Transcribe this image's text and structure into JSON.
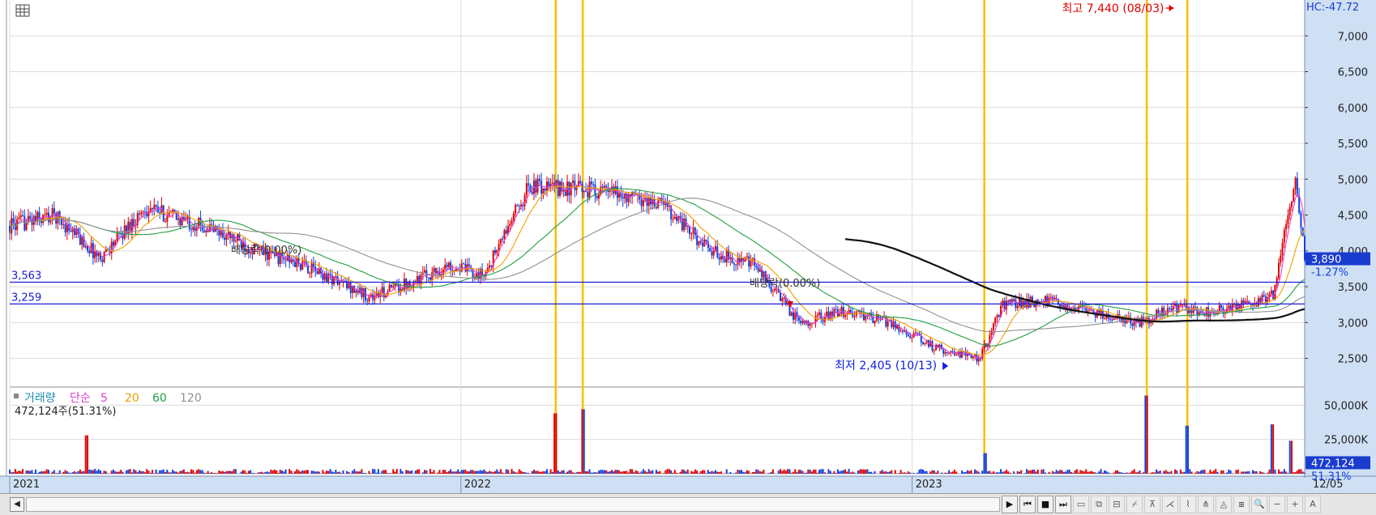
{
  "chart_data": {
    "type": "candlestick",
    "price_axis": {
      "min": 2100,
      "max": 7500,
      "ticks": [
        2500,
        3000,
        3500,
        4000,
        4500,
        5000,
        5500,
        6000,
        6500,
        7000
      ],
      "tick_labels": [
        "2,500",
        "3,000",
        "3,500",
        "4,000",
        "4,500",
        "5,000",
        "5,500",
        "6,000",
        "6,500",
        "7,000"
      ]
    },
    "volume_axis": {
      "max": 62000,
      "ticks": [
        25000,
        50000
      ],
      "tick_labels": [
        "25,000K",
        "50,000K"
      ]
    },
    "time_axis": {
      "start": 2021.0,
      "end": 2023.87,
      "labels": [
        {
          "t": 2021.0,
          "label": "2021"
        },
        {
          "t": 2022.0,
          "label": "2022"
        },
        {
          "t": 2023.0,
          "label": "2023"
        }
      ],
      "end_label": "12/05"
    },
    "price_series": [
      {
        "t": 2021.0,
        "v": 4350
      },
      {
        "t": 2021.1,
        "v": 4500
      },
      {
        "t": 2021.2,
        "v": 3900
      },
      {
        "t": 2021.3,
        "v": 4600
      },
      {
        "t": 2021.45,
        "v": 4300
      },
      {
        "t": 2021.55,
        "v": 4000
      },
      {
        "t": 2021.65,
        "v": 3800
      },
      {
        "t": 2021.72,
        "v": 3600
      },
      {
        "t": 2021.8,
        "v": 3350
      },
      {
        "t": 2021.9,
        "v": 3600
      },
      {
        "t": 2021.98,
        "v": 3800
      },
      {
        "t": 2022.05,
        "v": 3650
      },
      {
        "t": 2022.15,
        "v": 4900
      },
      {
        "t": 2022.3,
        "v": 4850
      },
      {
        "t": 2022.45,
        "v": 4650
      },
      {
        "t": 2022.55,
        "v": 4000
      },
      {
        "t": 2022.65,
        "v": 3800
      },
      {
        "t": 2022.75,
        "v": 3000
      },
      {
        "t": 2022.85,
        "v": 3150
      },
      {
        "t": 2022.95,
        "v": 3000
      },
      {
        "t": 2023.05,
        "v": 2650
      },
      {
        "t": 2023.15,
        "v": 2500
      },
      {
        "t": 2023.2,
        "v": 3250
      },
      {
        "t": 2023.3,
        "v": 3300
      },
      {
        "t": 2023.4,
        "v": 3150
      },
      {
        "t": 2023.5,
        "v": 3000
      },
      {
        "t": 2023.58,
        "v": 3200
      },
      {
        "t": 2023.65,
        "v": 3150
      },
      {
        "t": 2023.75,
        "v": 3250
      },
      {
        "t": 2023.8,
        "v": 3400
      },
      {
        "t": 2023.85,
        "v": 5000
      },
      {
        "t": 2023.87,
        "v": 3890
      }
    ],
    "moving_averages": [
      {
        "name": "5",
        "color": "#e040d0"
      },
      {
        "name": "20",
        "color": "#f0a000"
      },
      {
        "name": "60",
        "color": "#20a040"
      },
      {
        "name": "120",
        "color": "#909090"
      },
      {
        "name": "240",
        "color": "#111111"
      }
    ],
    "horizontal_lines": [
      {
        "value": 3563,
        "label": "3,563"
      },
      {
        "value": 3259,
        "label": "3,259"
      }
    ],
    "highlight_lines": [
      2022.21,
      2022.27,
      2023.16,
      2023.52,
      2023.61
    ],
    "annotations": {
      "high": {
        "text": "최고 7,440 (08/03)",
        "color": "#e00000"
      },
      "low": {
        "text": "최저 2,405 (10/13)",
        "color": "#1020e0"
      },
      "dividend_1": "배당락(0.00%)",
      "dividend_2": "배당락(0.00%)"
    },
    "current": {
      "price_label": "3,890",
      "change_label": "-1.27%",
      "volume_label": "472,124",
      "volume_pct_label": "51.31%"
    },
    "hc_label": "HC:-47.72",
    "volume_legend": {
      "vol_label": "거래량",
      "ma_label": "단순",
      "periods": [
        "5",
        "20",
        "60",
        "120"
      ],
      "colors": [
        "#e040d0",
        "#f0a000",
        "#20a040",
        "#909090"
      ],
      "summary": "472,124주(51.31%)"
    },
    "colors": {
      "up": "#e00000",
      "down": "#1040e0",
      "axis_bg": "#cfe0f4",
      "highlight": "#f8c000",
      "level": "#1a1ad8",
      "grid": "#dcdcdc"
    }
  },
  "toolbar": {
    "scroll_left": "◀",
    "buttons": [
      "▶",
      "⏮",
      "■",
      "⏭",
      "▭",
      "⧉",
      "⊟",
      "⌿",
      "⊼",
      "⋌",
      "⌇",
      "⋔",
      "◬",
      "⧆",
      "🔍",
      "−",
      "+",
      "A"
    ]
  }
}
